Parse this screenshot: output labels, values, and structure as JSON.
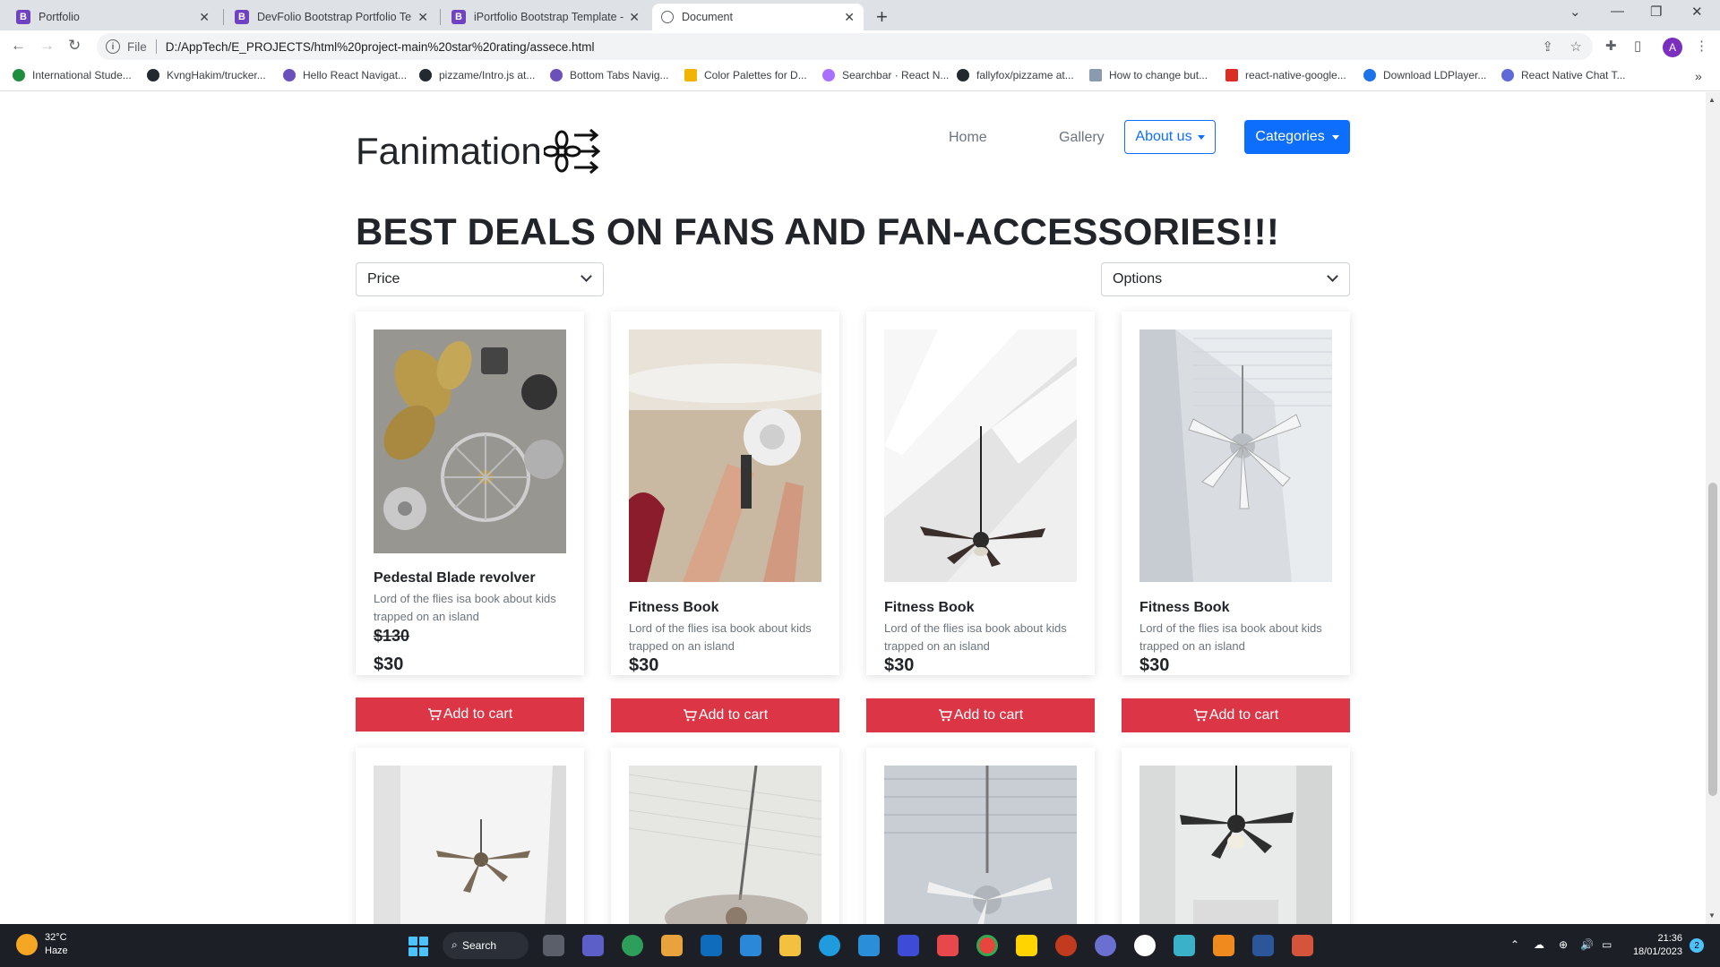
{
  "browser": {
    "tabs": [
      {
        "title": "Portfolio",
        "favicon": "B",
        "active": false
      },
      {
        "title": "DevFolio Bootstrap Portfolio Tem",
        "favicon": "B",
        "active": false
      },
      {
        "title": "iPortfolio Bootstrap Template - In",
        "favicon": "B",
        "active": false
      },
      {
        "title": "Document",
        "favicon": "globe",
        "active": true
      }
    ],
    "address": {
      "scheme_label": "File",
      "url": "D:/AppTech/E_PROJECTS/html%20project-main%20star%20rating/assece.html"
    },
    "profile_initial": "A",
    "bookmarks": [
      {
        "label": "International Stude...",
        "color": "#1e8e3e"
      },
      {
        "label": "KvngHakim/trucker...",
        "color": "#24292f"
      },
      {
        "label": "Hello React Navigat...",
        "color": "#6b4fbb"
      },
      {
        "label": "pizzame/Intro.js at...",
        "color": "#24292f"
      },
      {
        "label": "Bottom Tabs Navig...",
        "color": "#6b4fbb"
      },
      {
        "label": "Color Palettes for D...",
        "color": "#f2b400"
      },
      {
        "label": "Searchbar · React N...",
        "color": "#a970ff"
      },
      {
        "label": "fallyfox/pizzame at...",
        "color": "#24292f"
      },
      {
        "label": "How to change but...",
        "color": "#8a9bb0"
      },
      {
        "label": "react-native-google...",
        "color": "#d93025"
      },
      {
        "label": "Download LDPlayer...",
        "color": "#1a73e8"
      },
      {
        "label": "React Native Chat T...",
        "color": "#5f6ad8"
      }
    ]
  },
  "site": {
    "brand": "Fanimation",
    "nav": {
      "home": "Home",
      "gallery": "Gallery",
      "about": "About us",
      "categories": "Categories"
    },
    "heading": "BEST DEALS ON FANS AND FAN-ACCESSORIES!!!",
    "filters": {
      "price": "Price",
      "options": "Options"
    },
    "cart_label": "Add to cart",
    "products": [
      {
        "title": "Pedestal Blade revolver",
        "desc": "Lord of the flies isa book about kids trapped on an island",
        "old_price": "$130",
        "price": "$30",
        "image": "fan-parts-photo"
      },
      {
        "title": "Fitness Book",
        "desc": "Lord of the flies isa book about kids trapped on an island",
        "price": "$30",
        "image": "fan-installation-photo"
      },
      {
        "title": "Fitness Book",
        "desc": "Lord of the flies isa book about kids trapped on an island",
        "price": "$30",
        "image": "dark-ceiling-fan-photo"
      },
      {
        "title": "Fitness Book",
        "desc": "Lord of the flies isa book about kids trapped on an island",
        "price": "$30",
        "image": "white-ceiling-fan-photo"
      }
    ],
    "row2_images": [
      "ceiling-fan-corner-photo",
      "spinning-fan-photo",
      "white-fan-beams-photo",
      "dark-fan-hall-photo"
    ]
  },
  "taskbar": {
    "weather_temp": "32°C",
    "weather_desc": "Haze",
    "search_label": "Search",
    "time": "21:36",
    "date": "18/01/2023",
    "notifications": "2"
  },
  "colors": {
    "primary": "#0d6efd",
    "danger": "#dc3545",
    "text": "#212529",
    "muted": "#6c757d"
  }
}
